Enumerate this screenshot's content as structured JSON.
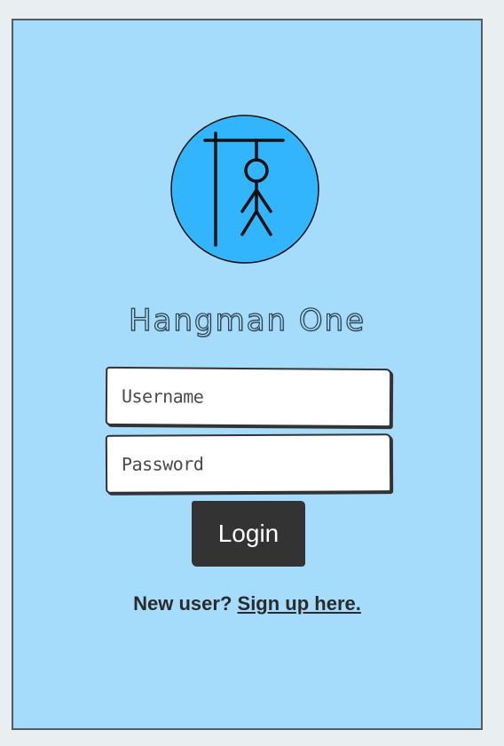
{
  "app": {
    "title": "Hangman One"
  },
  "logo": {
    "icon": "hangman-gallows-icon",
    "circle_color": "#33b5fd"
  },
  "form": {
    "username_placeholder": "Username",
    "username_value": "",
    "password_placeholder": "Password",
    "password_value": "",
    "login_label": "Login"
  },
  "signup": {
    "prompt": "New user?",
    "link_text": "Sign up here."
  },
  "colors": {
    "page_background": "#e9eef0",
    "panel_background": "#a6dcfb",
    "button_background": "#333333",
    "text_dark": "#2b2b2b"
  }
}
